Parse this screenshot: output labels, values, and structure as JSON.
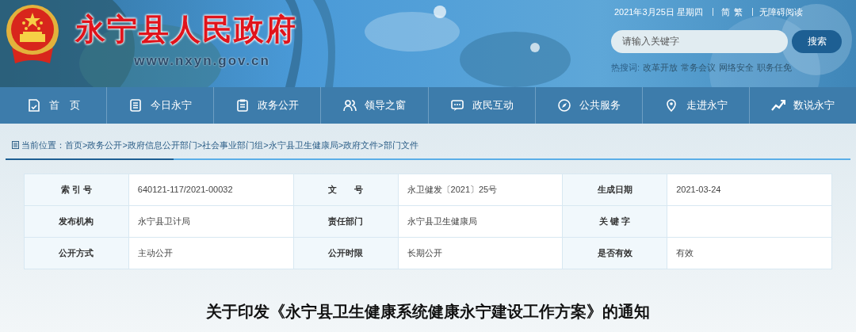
{
  "header": {
    "site_title": "永宁县人民政府",
    "site_url": "www.nxyn.gov.cn",
    "date": "2021年3月25日 星期四",
    "languages": [
      "简",
      "繁"
    ],
    "accessibility": "无障碍阅读",
    "search": {
      "placeholder": "请输入关键字",
      "button": "搜索"
    },
    "hot_words_label": "热搜词:",
    "hot_words": [
      "改革开放",
      "常务会议",
      "网络安全",
      "职务任免"
    ]
  },
  "nav": [
    {
      "label": "首　页"
    },
    {
      "label": "今日永宁"
    },
    {
      "label": "政务公开"
    },
    {
      "label": "领导之窗"
    },
    {
      "label": "政民互动"
    },
    {
      "label": "公共服务"
    },
    {
      "label": "走进永宁"
    },
    {
      "label": "数说永宁"
    }
  ],
  "breadcrumb": "当前位置：首页>政务公开>政府信息公开部门>社会事业部门组>永宁县卫生健康局>政府文件>部门文件",
  "info_table": [
    [
      {
        "label": "索 引 号",
        "value": "640121-117/2021-00032"
      },
      {
        "label": "文　　号",
        "value": "永卫健发〔2021〕25号"
      },
      {
        "label": "生成日期",
        "value": "2021-03-24"
      }
    ],
    [
      {
        "label": "发布机构",
        "value": "永宁县卫计局"
      },
      {
        "label": "责任部门",
        "value": "永宁县卫生健康局"
      },
      {
        "label": "关 键 字"
      }
    ],
    [
      {
        "label": "公开方式",
        "value": "主动公开"
      },
      {
        "label": "公开时限",
        "value": "长期公开"
      },
      {
        "label": "是否有效",
        "value": "有效"
      }
    ]
  ],
  "article_title": "关于印发《永宁县卫生健康系统健康永宁建设工作方案》的通知"
}
